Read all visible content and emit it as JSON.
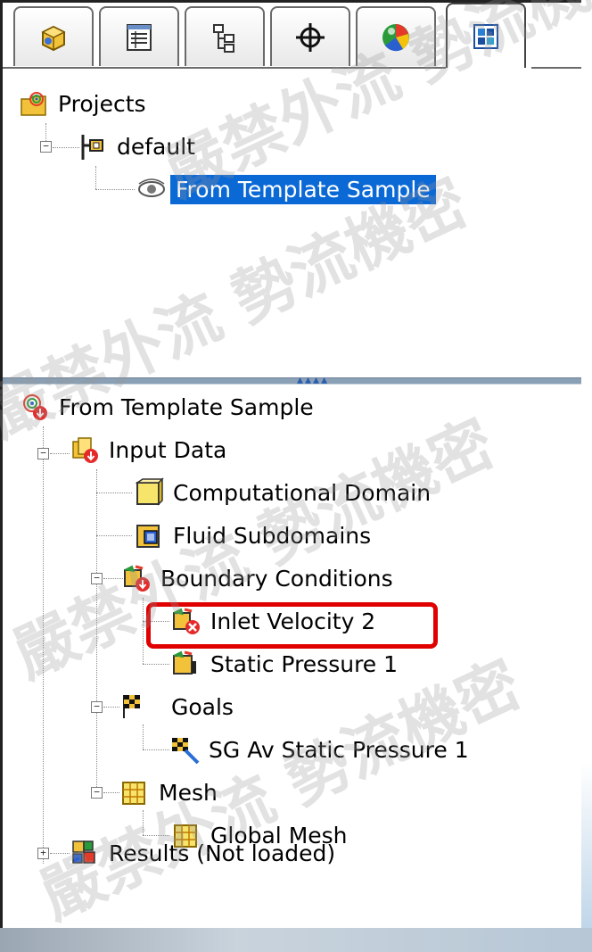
{
  "tabs": [
    {
      "id": "part",
      "icon": "part-icon"
    },
    {
      "id": "property",
      "icon": "property-manager-icon"
    },
    {
      "id": "config",
      "icon": "configuration-icon"
    },
    {
      "id": "dimxpert",
      "icon": "dimxpert-icon"
    },
    {
      "id": "display",
      "icon": "display-manager-icon"
    },
    {
      "id": "flow",
      "icon": "flow-analysis-icon",
      "active": true
    }
  ],
  "projects_tree": {
    "root": "Projects",
    "config": "default",
    "project": "From Template Sample"
  },
  "analysis_tree": {
    "root": "From Template Sample",
    "input_data": "Input Data",
    "computational_domain": "Computational Domain",
    "fluid_subdomains": "Fluid Subdomains",
    "boundary_conditions": "Boundary Conditions",
    "inlet_velocity": "Inlet Velocity 2",
    "static_pressure": "Static Pressure 1",
    "goals": "Goals",
    "goal_item": "SG Av Static Pressure 1",
    "mesh": "Mesh",
    "global_mesh": "Global Mesh",
    "results": "Results (Not loaded)"
  },
  "watermark": "嚴禁外流 勢流機密",
  "colors": {
    "selection": "#0b69d6",
    "highlight": "#e00000"
  }
}
